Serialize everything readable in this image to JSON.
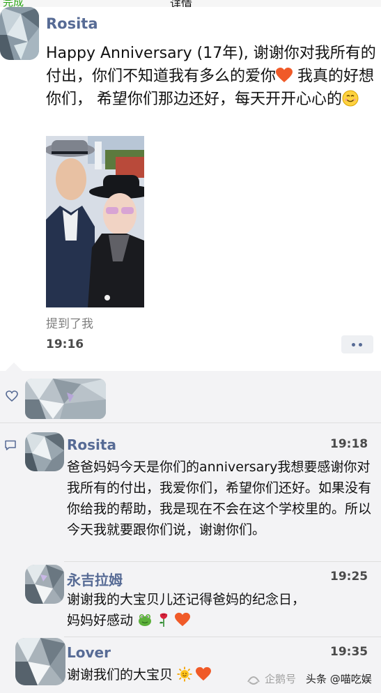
{
  "header": {
    "back_label": "完成",
    "title": "详情"
  },
  "post": {
    "author": "Rosita",
    "text_part1": "Happy Anniversary (17年), 谢谢你对我所有的付出，你们不知道我有多么的爱你",
    "text_part2": "我真的好想你们， 希望你们那边还好，每天开开心心的",
    "mention_text": "提到了我",
    "time": "19:16"
  },
  "comments": [
    {
      "author": "Rosita",
      "time": "19:18",
      "text": "爸爸妈妈今天是你们的anniversary我想要感谢你对我所有的付出，我爱你们，希望你们还好。如果没有你给我的帮助，我是现在不会在这个学校里的。所以今天我就要跟你们说，谢谢你们。"
    },
    {
      "author": "永吉拉姆",
      "time": "19:25",
      "text_line1": "谢谢我的大宝贝儿还记得爸妈的纪念日，",
      "text_line2": "妈妈好感动"
    },
    {
      "author": "Lover",
      "time": "19:35",
      "text": "谢谢我们的大宝贝"
    }
  ],
  "icons": {
    "heart_emoji": "heart-icon",
    "smile_emoji": "smile-icon",
    "frog_emoji": "frog-icon",
    "rose_emoji": "rose-icon",
    "sun_emoji": "sun-icon",
    "like_icon": "like-heart-icon",
    "comment_icon": "comment-icon",
    "more_icon": "more-dots-icon"
  },
  "watermark": {
    "platform": "企鹅号",
    "source": "头条 @喵吃娱"
  },
  "colors": {
    "name_link": "#576b95",
    "panel_bg": "#f3f3f5",
    "heart": "#f05a28"
  }
}
